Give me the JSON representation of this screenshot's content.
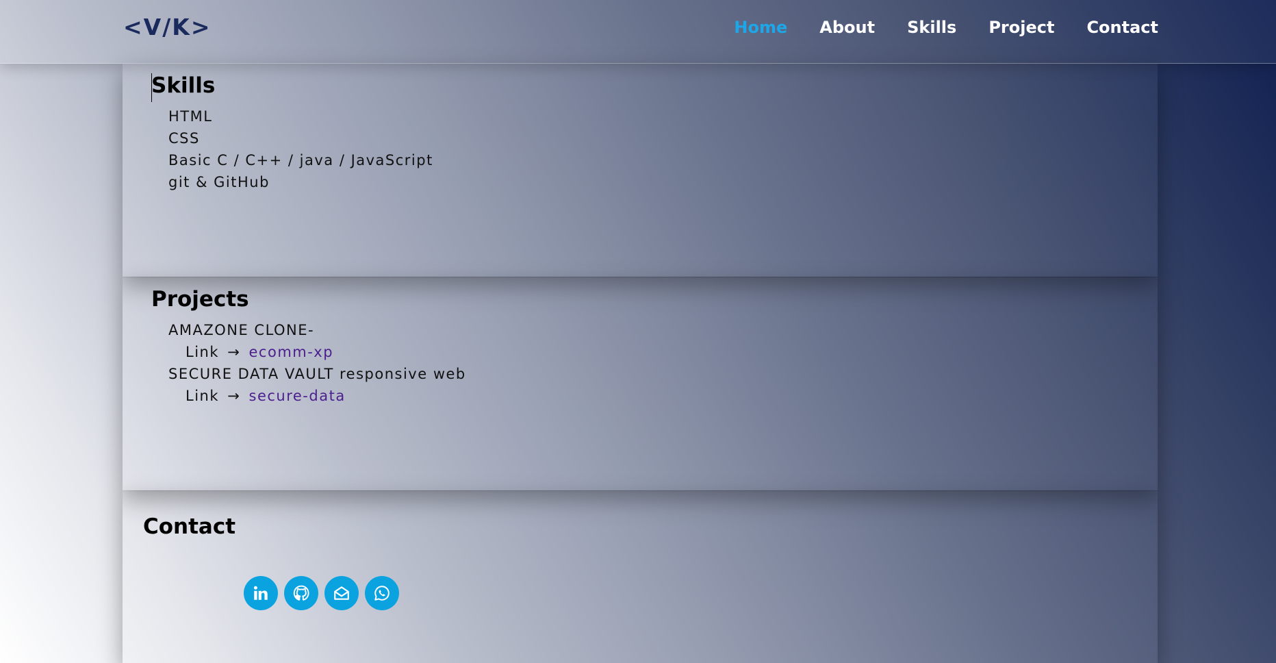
{
  "nav": {
    "logo": "<V/K>",
    "links": [
      "Home",
      "About",
      "Skills",
      "Project",
      "Contact"
    ],
    "active": "Home",
    "accent_color": "#1ea7e8"
  },
  "skills": {
    "title": "Skills",
    "items": [
      "HTML",
      "CSS",
      "Basic C / C++ / java / JavaScript",
      "git & GitHub"
    ]
  },
  "projects": {
    "title": "Projects",
    "items": [
      {
        "name": "AMAZONE CLONE-",
        "link_label": "Link",
        "arrow": "→",
        "link_text": "ecomm-xp"
      },
      {
        "name": "SECURE DATA VAULT responsive web",
        "link_label": "Link",
        "arrow": "→",
        "link_text": "secure-data"
      }
    ],
    "link_color": "#4b1f8e"
  },
  "contact": {
    "title": "Contact",
    "socials": [
      {
        "icon": "linkedin-icon"
      },
      {
        "icon": "github-icon"
      },
      {
        "icon": "email-icon"
      },
      {
        "icon": "whatsapp-icon"
      }
    ],
    "social_color": "#0aa3e0"
  }
}
